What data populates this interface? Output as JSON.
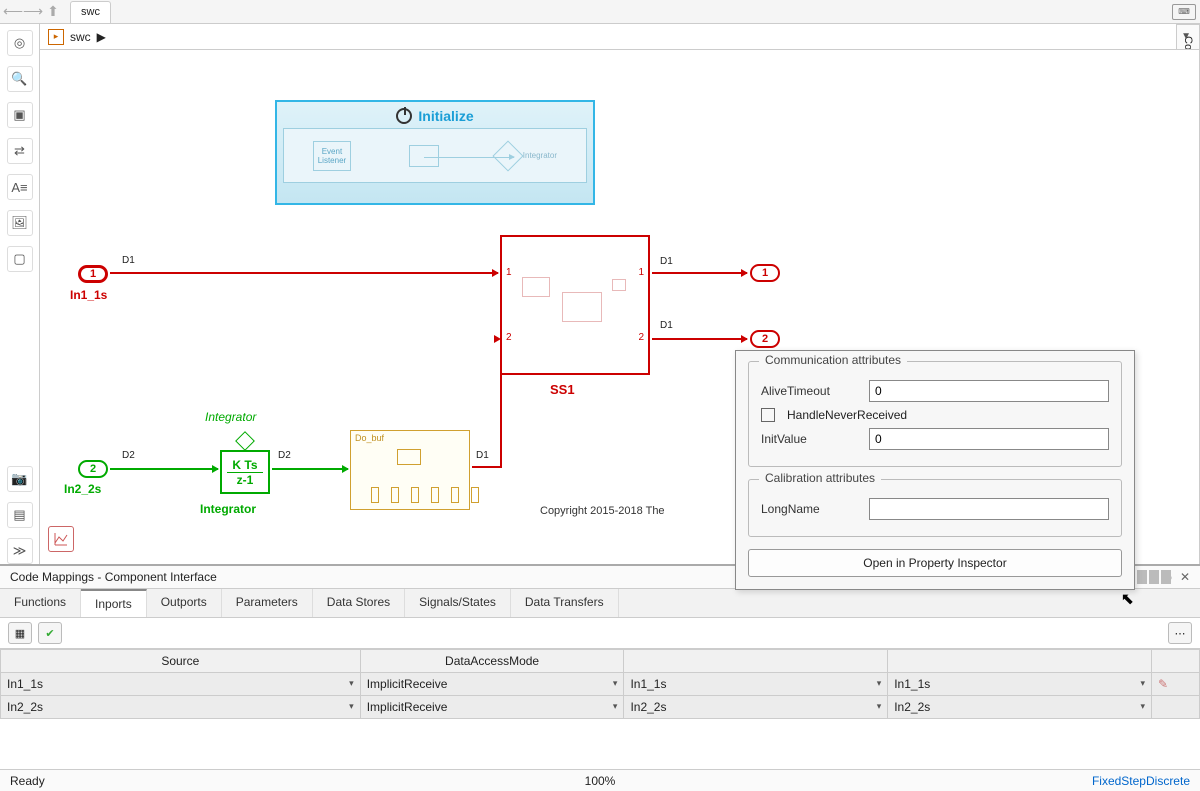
{
  "tab": {
    "label": "swc"
  },
  "side": {
    "code": "Code"
  },
  "breadcrumb": {
    "model": "swc"
  },
  "diagram": {
    "init_label": "Initialize",
    "init_event": "Event Listener",
    "init_integrator": "Integrator",
    "in1": "1",
    "in1_label": "In1_1s",
    "in1_sig": "D1",
    "in2": "2",
    "in2_label": "In2_2s",
    "in2_sig": "D2",
    "out1": "1",
    "out2": "2",
    "ss1": "SS1",
    "ss1_p1": "1",
    "ss1_p2": "2",
    "ss1_out1": "D1",
    "ss1_out2": "D1",
    "integrator_name": "Integrator",
    "integrator_gain_top": "K Ts",
    "integrator_gain_bot": "z-1",
    "integrator_below": "Integrator",
    "dobuf": "Do_buf",
    "dobuf_sig": "D1",
    "copyright": "Copyright 2015-2018 The"
  },
  "popup": {
    "g1": "Communication attributes",
    "alive": "AliveTimeout",
    "alive_val": "0",
    "handle": "HandleNeverReceived",
    "initv": "InitValue",
    "initv_val": "0",
    "g2": "Calibration attributes",
    "longname": "LongName",
    "longname_val": "",
    "open": "Open in Property Inspector"
  },
  "cm": {
    "title": "Code Mappings - Component Interface",
    "tabs": [
      "Functions",
      "Inports",
      "Outports",
      "Parameters",
      "Data Stores",
      "Signals/States",
      "Data Transfers"
    ],
    "active_tab": 1,
    "cols": [
      "Source",
      "DataAccessMode",
      "",
      ""
    ],
    "rows": [
      {
        "src": "In1_1s",
        "mode": "ImplicitReceive",
        "c3": "In1_1s",
        "c4": "In1_1s"
      },
      {
        "src": "In2_2s",
        "mode": "ImplicitReceive",
        "c3": "In2_2s",
        "c4": "In2_2s"
      }
    ]
  },
  "status": {
    "left": "Ready",
    "mid": "100%",
    "right": "FixedStepDiscrete"
  }
}
